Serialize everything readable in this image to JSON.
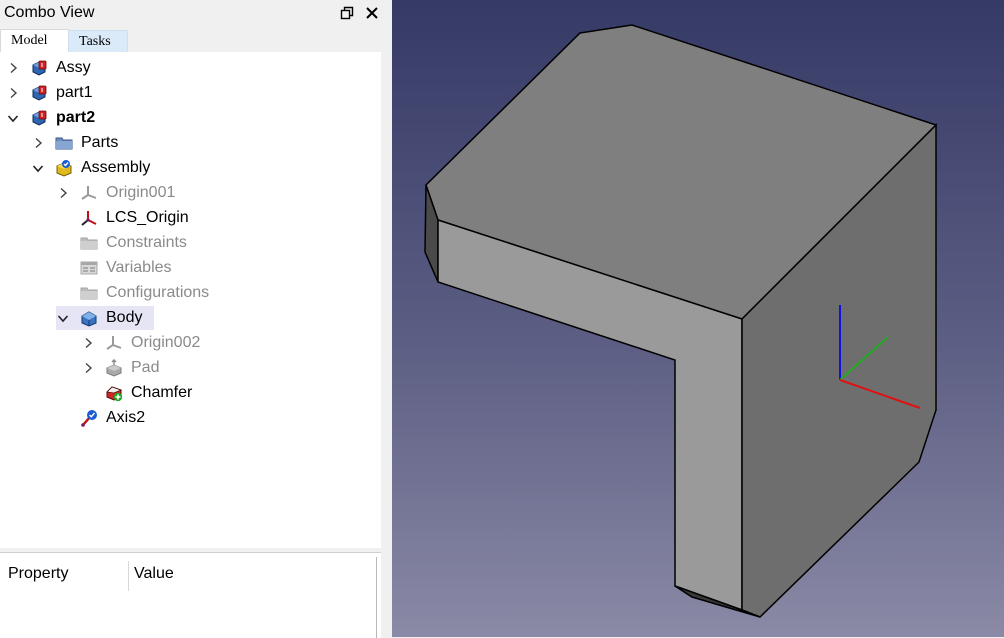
{
  "combo": {
    "title": "Combo View",
    "tabs": [
      "Model",
      "Tasks"
    ]
  },
  "tree": [
    {
      "label": "Assy",
      "icon": "part-icon",
      "expand": "collapsed",
      "state": "normal"
    },
    {
      "label": "part1",
      "icon": "part-icon",
      "expand": "collapsed",
      "state": "normal"
    },
    {
      "label": "part2",
      "icon": "part-icon",
      "expand": "expanded",
      "state": "bold"
    },
    {
      "label": "Parts",
      "icon": "folder-icon",
      "expand": "collapsed",
      "state": "normal"
    },
    {
      "label": "Assembly",
      "icon": "assembly-icon",
      "expand": "expanded",
      "state": "normal"
    },
    {
      "label": "Origin001",
      "icon": "origin-icon",
      "expand": "collapsed",
      "state": "dim"
    },
    {
      "label": "LCS_Origin",
      "icon": "lcs-icon",
      "expand": "none",
      "state": "normal"
    },
    {
      "label": "Constraints",
      "icon": "folder-grey-icon",
      "expand": "none",
      "state": "dim"
    },
    {
      "label": "Variables",
      "icon": "variables-icon",
      "expand": "none",
      "state": "dim"
    },
    {
      "label": "Configurations",
      "icon": "folder-grey-icon",
      "expand": "none",
      "state": "dim"
    },
    {
      "label": "Body",
      "icon": "body-icon",
      "expand": "expanded",
      "state": "selected"
    },
    {
      "label": "Origin002",
      "icon": "origin-icon",
      "expand": "collapsed",
      "state": "dim"
    },
    {
      "label": "Pad",
      "icon": "pad-icon",
      "expand": "collapsed",
      "state": "dim"
    },
    {
      "label": "Chamfer",
      "icon": "chamfer-icon",
      "expand": "none",
      "state": "normal"
    },
    {
      "label": "Axis2",
      "icon": "axis-icon",
      "expand": "none",
      "state": "normal"
    }
  ],
  "properties": {
    "col_property": "Property",
    "col_value": "Value"
  },
  "viewport": {
    "axis_colors": {
      "x": "#e01010",
      "y": "#22aa22",
      "z": "#1010e0"
    }
  }
}
